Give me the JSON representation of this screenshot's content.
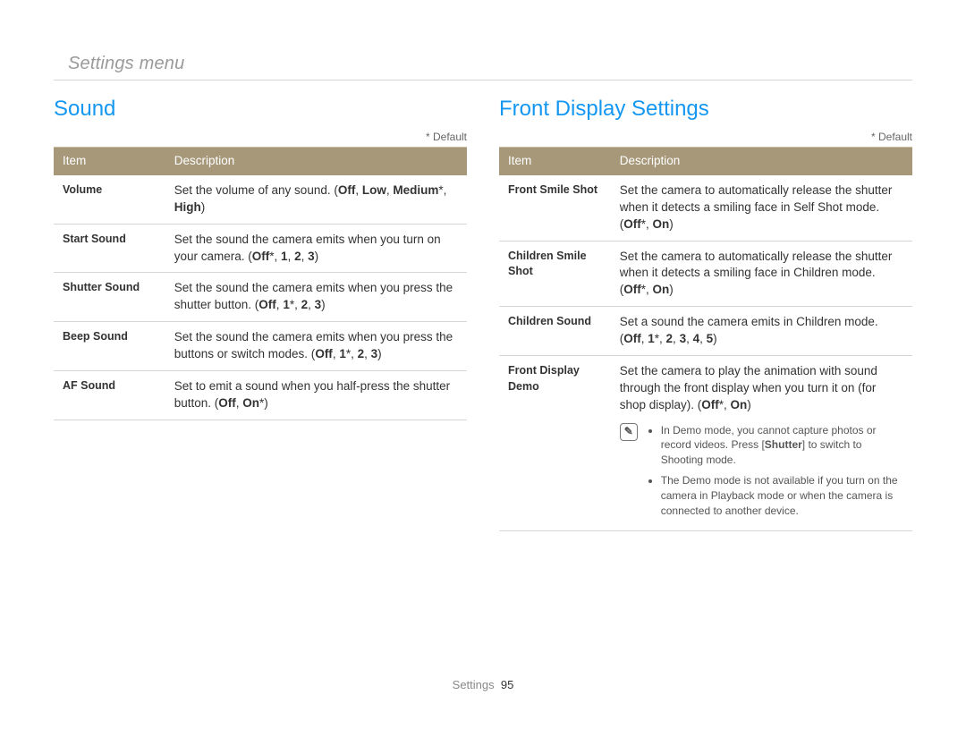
{
  "breadcrumb": "Settings menu",
  "footer": {
    "section": "Settings",
    "page": "95"
  },
  "default_note": "* Default",
  "headers": {
    "item": "Item",
    "description": "Description"
  },
  "note_icon_glyph": "✎",
  "left": {
    "title": "Sound",
    "rows": [
      {
        "item": "Volume",
        "desc_html": "Set the volume of any sound. (<b>Off</b>, <b>Low</b>, <b>Medium</b>*, <b>High</b>)"
      },
      {
        "item": "Start Sound",
        "desc_html": "Set the sound the camera emits when you turn on your camera. (<b>Off</b>*, <b>1</b>, <b>2</b>, <b>3</b>)"
      },
      {
        "item": "Shutter Sound",
        "desc_html": "Set the sound the camera emits when you press the shutter button. (<b>Off</b>, <b>1</b>*, <b>2</b>, <b>3</b>)"
      },
      {
        "item": "Beep Sound",
        "desc_html": "Set the sound the camera emits when you press the buttons or switch modes. (<b>Off</b>, <b>1</b>*, <b>2</b>, <b>3</b>)"
      },
      {
        "item": "AF Sound",
        "desc_html": "Set to emit a sound when you half-press the shutter button. (<b>Off</b>, <b>On</b>*)"
      }
    ]
  },
  "right": {
    "title": "Front Display Settings",
    "rows": [
      {
        "item": "Front Smile Shot",
        "desc_html": "Set the camera to automatically release the shutter when it detects a smiling face in Self Shot mode. (<b>Off</b>*, <b>On</b>)"
      },
      {
        "item": "Children Smile Shot",
        "desc_html": "Set the camera to automatically release the shutter when it detects a smiling face in Children mode. (<b>Off</b>*, <b>On</b>)"
      },
      {
        "item": "Children Sound",
        "desc_html": "Set a sound the camera emits in Children mode. (<b>Off</b>, <b>1</b>*, <b>2</b>, <b>3</b>, <b>4</b>, <b>5</b>)"
      },
      {
        "item": "Front Display Demo",
        "desc_html": "Set the camera to play the animation with sound through the front display when you turn it on (for shop display). (<b>Off</b>*, <b>On</b>)",
        "notes": [
          "In Demo mode, you cannot capture photos or record videos. Press [<b>Shutter</b>] to switch to Shooting mode.",
          "The Demo mode is not available if you turn on the camera in Playback mode or when the camera is connected to another device."
        ]
      }
    ]
  }
}
